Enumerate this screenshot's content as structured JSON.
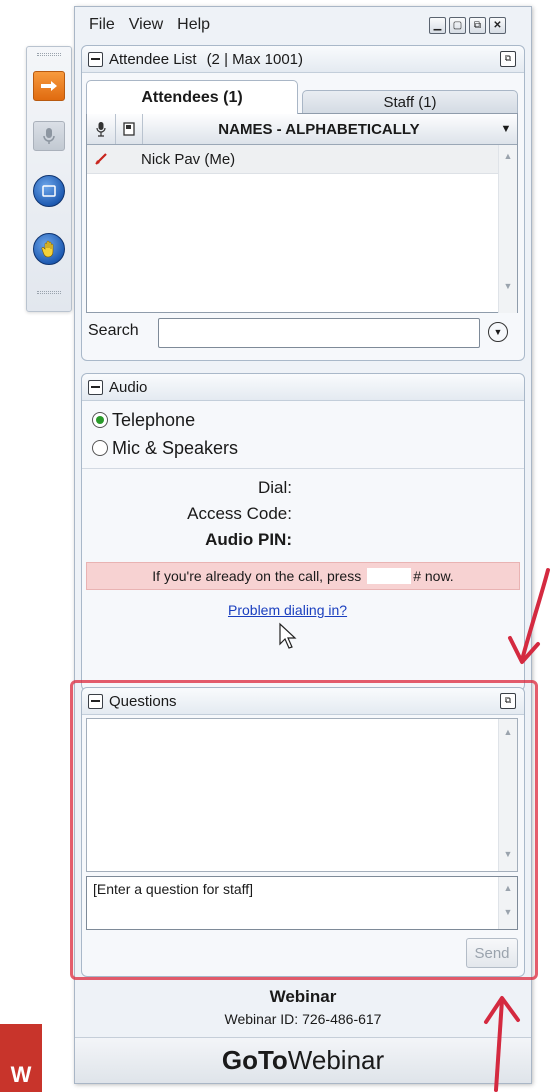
{
  "menu": {
    "items": [
      "File",
      "View",
      "Help"
    ]
  },
  "window_controls": {
    "minimize": "▁",
    "restore": "▢",
    "popout": "⧉",
    "close": "✕"
  },
  "attendee_panel": {
    "title": "Attendee List",
    "count_text": "(2 | Max 1001)",
    "tabs": {
      "attendees": "Attendees (1)",
      "staff": "Staff (1)"
    },
    "column_header": "NAMES - ALPHABETICALLY",
    "rows": [
      {
        "name": "Nick Pav (Me)"
      }
    ],
    "search_label": "Search",
    "search_value": ""
  },
  "audio_panel": {
    "title": "Audio",
    "options": [
      "Telephone",
      "Mic & Speakers"
    ],
    "selected_option": "Telephone",
    "dial_label": "Dial:",
    "access_code_label": "Access Code:",
    "pin_label": "Audio PIN:",
    "notice_prefix": "If you're already on the call, press",
    "notice_suffix": "# now.",
    "problem_link": "Problem dialing in?"
  },
  "questions_panel": {
    "title": "Questions",
    "input_placeholder": "[Enter a question for staff]",
    "send_label": "Send"
  },
  "footer": {
    "title": "Webinar",
    "id_text": "Webinar ID: 726-486-617",
    "brand_bold": "GoTo",
    "brand_light": "Webinar"
  },
  "corner_badge": "W",
  "colors": {
    "accent_orange": "#e8751a",
    "annotation_red": "#dc283c",
    "notice_bg": "#f7d2d2",
    "link_blue": "#1a3fbf",
    "panel_border": "#a9b8c9"
  }
}
